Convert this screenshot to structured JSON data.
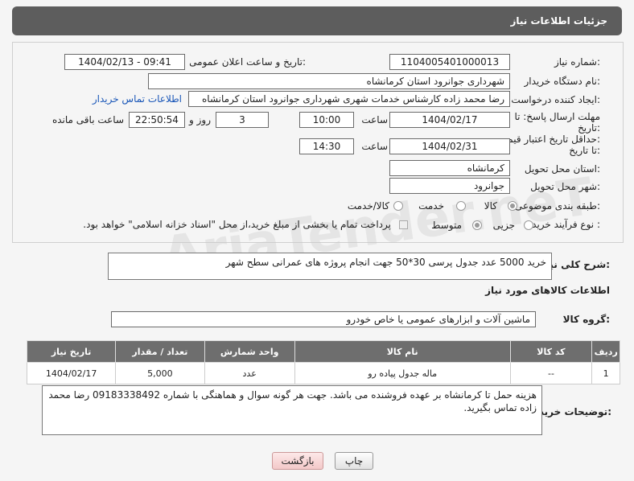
{
  "header": {
    "title": "جزئیات اطلاعات نیاز"
  },
  "fields": {
    "need_number_label": "شماره نیاز:",
    "need_number": "1104005401000013",
    "announce_label": "تاریخ و ساعت اعلان عمومی:",
    "announce_value": "1404/02/13 - 09:41",
    "buyer_org_label": "نام دستگاه خریدار:",
    "buyer_org": "شهرداری جوانرود استان کرمانشاه",
    "creator_label": "ایجاد کننده درخواست:",
    "creator": "رضا محمد زاده کارشناس خدمات شهری شهرداری جوانرود استان کرمانشاه",
    "contact_link": "اطلاعات تماس خریدار",
    "deadline_label_1": "مهلت ارسال پاسخ: تا",
    "deadline_label_2": "تاریخ:",
    "deadline_date": "1404/02/17",
    "time_label": "ساعت",
    "deadline_time": "10:00",
    "days_value": "3",
    "days_label": "روز و",
    "remaining_time": "22:50:54",
    "remaining_label": "ساعت باقی مانده",
    "min_price_label_1": "حداقل تاریخ اعتبار قیمت:",
    "min_price_label_2": "تا تاریخ:",
    "min_price_date": "1404/02/31",
    "min_price_time_label": "ساعت",
    "min_price_time": "14:30",
    "province_label": "استان محل تحویل:",
    "province": "کرمانشاه",
    "city_label": "شهر محل تحویل:",
    "city": "جوانرود",
    "category_label": "طبقه بندی موضوعی:",
    "category_options": [
      "کالا",
      "خدمت",
      "کالا/خدمت"
    ],
    "purchase_type_label": "نوع فرآیند خرید :",
    "purchase_options": [
      "جزیی",
      "متوسط"
    ],
    "purchase_note": "پرداخت تمام یا بخشی از مبلغ خرید،از محل \"اسناد خزانه اسلامی\" خواهد بود."
  },
  "description": {
    "label": "شرح کلی نیاز:",
    "text": "خرید 5000 عدد جدول پرسی 30*50 جهت انجام پروژه های عمرانی سطح شهر"
  },
  "goods": {
    "section_title": "اطلاعات کالاهای مورد نیاز",
    "group_label": "گروه کالا:",
    "group_value": "ماشین آلات و ابزارهای عمومی یا خاص خودرو",
    "columns": [
      "ردیف",
      "کد کالا",
      "نام کالا",
      "واحد شمارش",
      "تعداد / مقدار",
      "تاریخ نیاز"
    ],
    "rows": [
      {
        "index": "1",
        "code": "--",
        "name": "ماله جدول پیاده رو",
        "unit": "عدد",
        "qty": "5,000",
        "date": "1404/02/17"
      }
    ]
  },
  "buyer_notes": {
    "label": "توضیحات خریدار:",
    "text": "هزینه حمل تا کرمانشاه بر عهده فروشنده می باشد. جهت هر گونه سوال و هماهنگی با شماره 09183338492 رضا محمد زاده تماس بگیرید."
  },
  "buttons": {
    "print": "چاپ",
    "back": "بازگشت"
  },
  "watermark": "AriaTender.neT"
}
